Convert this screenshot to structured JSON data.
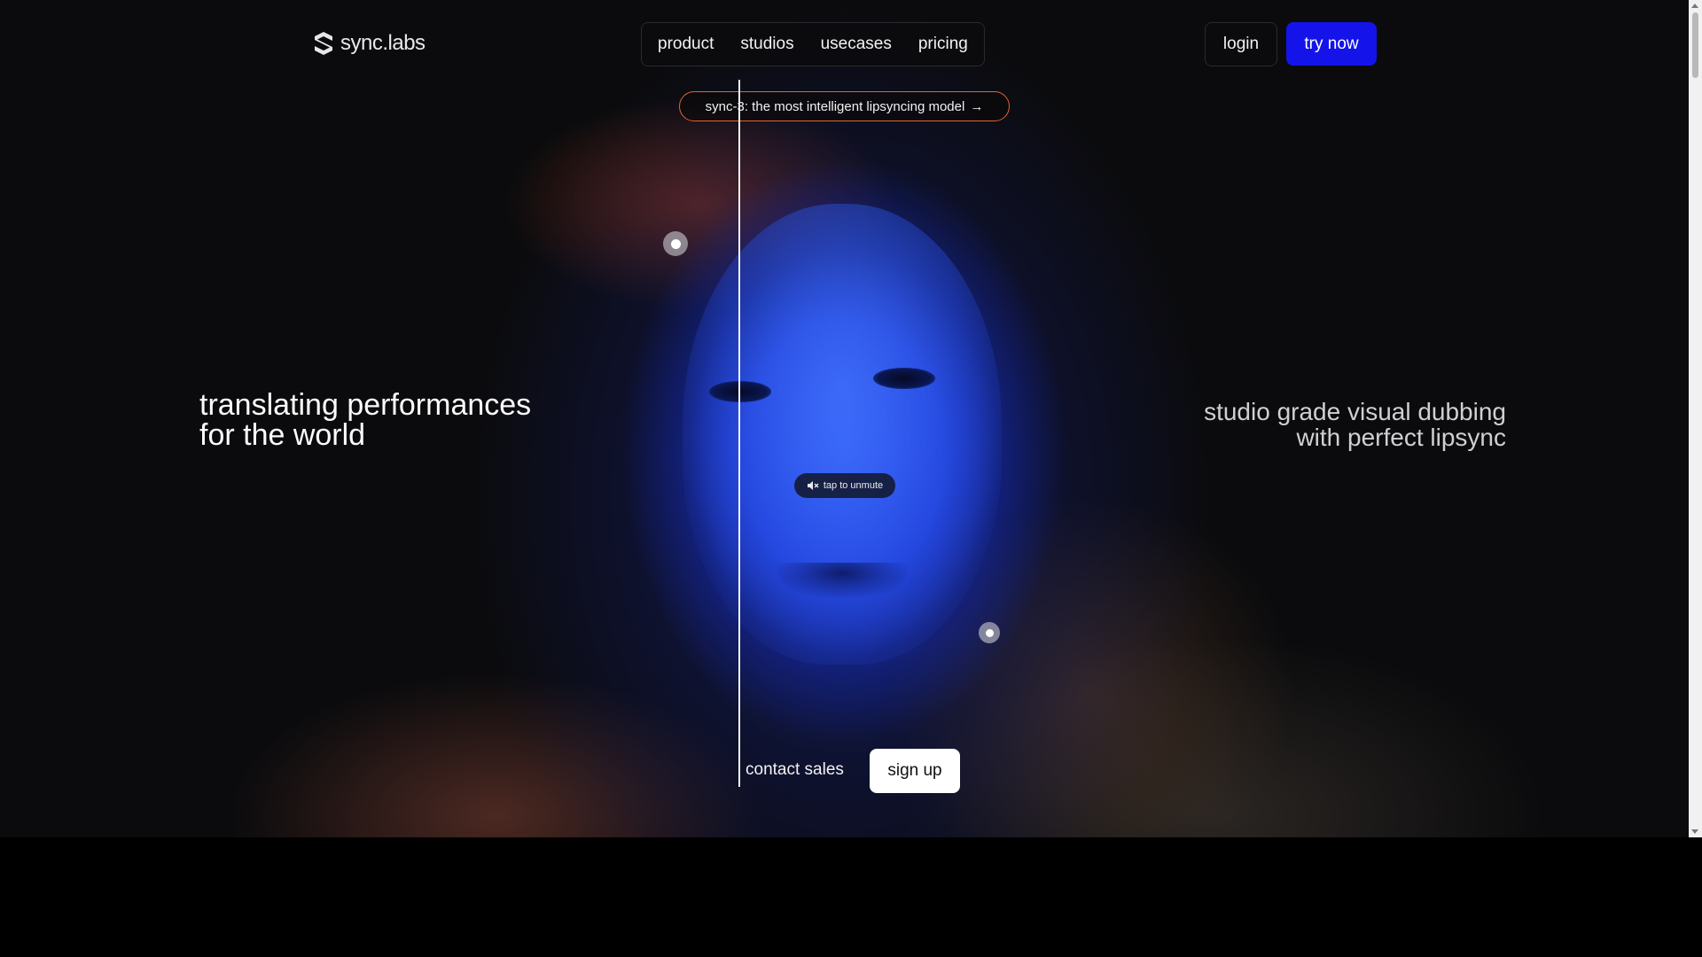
{
  "header": {
    "logo_text": "sync.labs",
    "nav": [
      {
        "label": "product"
      },
      {
        "label": "studios"
      },
      {
        "label": "usecases"
      },
      {
        "label": "pricing"
      }
    ],
    "login_label": "login",
    "try_label": "try now"
  },
  "announcement": {
    "text": "sync-3: the most intelligent lipsyncing model",
    "arrow": "→"
  },
  "hero": {
    "headline_left_line1": "translating performances",
    "headline_left_line2": "for the world",
    "headline_right_line1": "studio grade visual dubbing",
    "headline_right_line2": "with perfect lipsync",
    "unmute_label": "tap to unmute",
    "contact_label": "contact sales",
    "signup_label": "sign up"
  },
  "colors": {
    "accent": "#1414ea",
    "announce_border": "#e8632d"
  }
}
